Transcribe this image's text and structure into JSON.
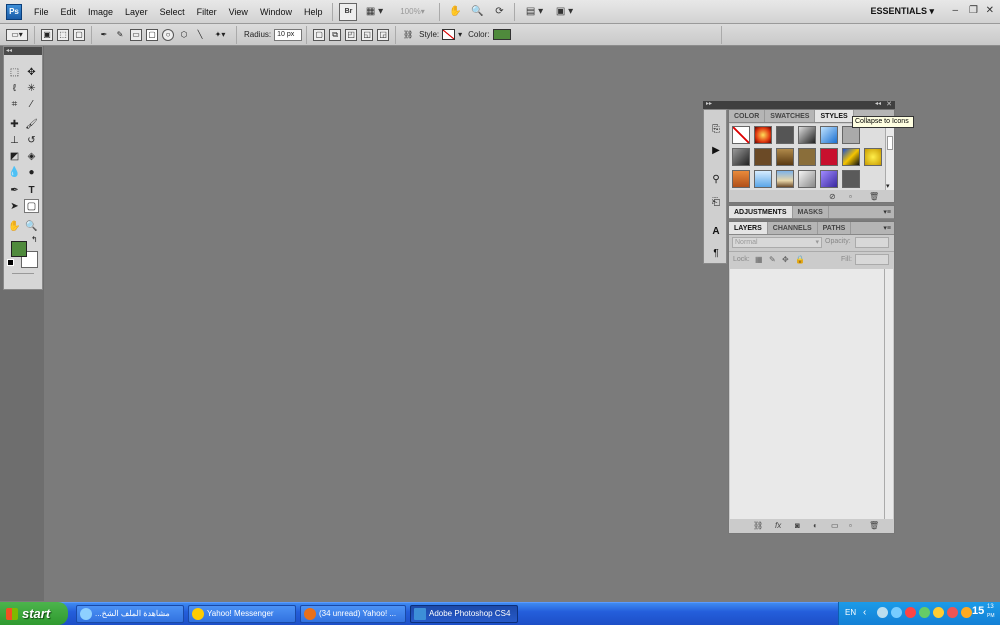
{
  "app": {
    "logo": "Ps",
    "workspace": "ESSENTIALS"
  },
  "menu": [
    "File",
    "Edit",
    "Image",
    "Layer",
    "Select",
    "Filter",
    "View",
    "Window",
    "Help"
  ],
  "menubar_tools": {
    "bridge": "Br",
    "zoom": "100%"
  },
  "options": {
    "radius_label": "Radius:",
    "radius_value": "10 px",
    "style_label": "Style:",
    "color_label": "Color:"
  },
  "colors": {
    "foreground": "#4f8a3c",
    "background": "#ffffff",
    "canvas": "#7b7b7b"
  },
  "panels": {
    "styles_tabs": [
      "COLOR",
      "SWATCHES",
      "STYLES"
    ],
    "adjust_tabs": [
      "ADJUSTMENTS",
      "MASKS"
    ],
    "layers_tabs": [
      "LAYERS",
      "CHANNELS",
      "PATHS"
    ],
    "blend_mode": "Normal",
    "opacity_label": "Opacity:",
    "lock_label": "Lock:",
    "fill_label": "Fill:"
  },
  "tooltip": "Collapse to Icons",
  "taskbar": {
    "start": "start",
    "tasks": [
      "مشاهدة الملف الشخ...",
      "Yahoo! Messenger",
      "(34 unread) Yahoo! ...",
      "Adobe Photoshop CS4"
    ],
    "lang": "EN",
    "clock": "15",
    "clock_min": "13",
    "clock_ampm": "PM"
  }
}
